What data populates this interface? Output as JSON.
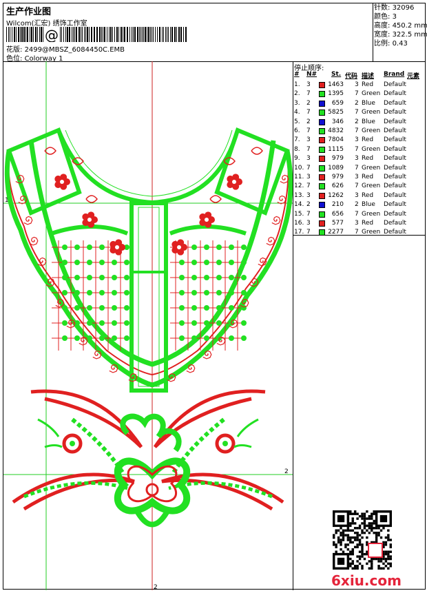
{
  "header": {
    "title": "生产作业图",
    "company": "Wilcom(汇宏) 绣饰工作室",
    "design_label": "花版:",
    "design_value": "2499@MBSZ_6084450C.EMB",
    "colorway_label": "色位:",
    "colorway_value": "Colorway 1",
    "barcode_mark": "@"
  },
  "stats": [
    {
      "label": "针数:",
      "value": "32096"
    },
    {
      "label": "颜色:",
      "value": "3"
    },
    {
      "label": "高度:",
      "value": "450.2 mm"
    },
    {
      "label": "宽度:",
      "value": "322.5 mm"
    },
    {
      "label": "比例:",
      "value": "0.43"
    }
  ],
  "stop_table": {
    "title": "停止顺序:",
    "headers": [
      "#",
      "N#",
      "St.",
      "代码",
      "描述",
      "Brand",
      "元素"
    ],
    "rows": [
      {
        "n": "1.",
        "nn": "3",
        "color": "#e02020",
        "st": "1463",
        "code": "3",
        "desc": "Red",
        "brand": "Default"
      },
      {
        "n": "2.",
        "nn": "7",
        "color": "#22e022",
        "st": "1395",
        "code": "7",
        "desc": "Green",
        "brand": "Default"
      },
      {
        "n": "3.",
        "nn": "2",
        "color": "#1010d0",
        "st": "659",
        "code": "2",
        "desc": "Blue",
        "brand": "Default"
      },
      {
        "n": "4.",
        "nn": "7",
        "color": "#22e022",
        "st": "5825",
        "code": "7",
        "desc": "Green",
        "brand": "Default"
      },
      {
        "n": "5.",
        "nn": "2",
        "color": "#1010d0",
        "st": "346",
        "code": "2",
        "desc": "Blue",
        "brand": "Default"
      },
      {
        "n": "6.",
        "nn": "7",
        "color": "#22e022",
        "st": "4832",
        "code": "7",
        "desc": "Green",
        "brand": "Default"
      },
      {
        "n": "7.",
        "nn": "3",
        "color": "#e02020",
        "st": "7804",
        "code": "3",
        "desc": "Red",
        "brand": "Default"
      },
      {
        "n": "8.",
        "nn": "7",
        "color": "#22e022",
        "st": "1115",
        "code": "7",
        "desc": "Green",
        "brand": "Default"
      },
      {
        "n": "9.",
        "nn": "3",
        "color": "#e02020",
        "st": "979",
        "code": "3",
        "desc": "Red",
        "brand": "Default"
      },
      {
        "n": "10.",
        "nn": "7",
        "color": "#22e022",
        "st": "1089",
        "code": "7",
        "desc": "Green",
        "brand": "Default"
      },
      {
        "n": "11.",
        "nn": "3",
        "color": "#e02020",
        "st": "979",
        "code": "3",
        "desc": "Red",
        "brand": "Default"
      },
      {
        "n": "12.",
        "nn": "7",
        "color": "#22e022",
        "st": "626",
        "code": "7",
        "desc": "Green",
        "brand": "Default"
      },
      {
        "n": "13.",
        "nn": "3",
        "color": "#e02020",
        "st": "1262",
        "code": "3",
        "desc": "Red",
        "brand": "Default"
      },
      {
        "n": "14.",
        "nn": "2",
        "color": "#1010d0",
        "st": "210",
        "code": "2",
        "desc": "Blue",
        "brand": "Default"
      },
      {
        "n": "15.",
        "nn": "7",
        "color": "#22e022",
        "st": "656",
        "code": "7",
        "desc": "Green",
        "brand": "Default"
      },
      {
        "n": "16.",
        "nn": "3",
        "color": "#e02020",
        "st": "577",
        "code": "3",
        "desc": "Red",
        "brand": "Default"
      },
      {
        "n": "17.",
        "nn": "7",
        "color": "#22e022",
        "st": "2277",
        "code": "7",
        "desc": "Green",
        "brand": "Default"
      }
    ]
  },
  "guides": {
    "label_1": "1",
    "label_2": "2"
  },
  "watermark": "6xiu.com",
  "colors": {
    "red": "#e02020",
    "green": "#22e022",
    "guide": "#22cc22",
    "wm": "#e4243a"
  }
}
